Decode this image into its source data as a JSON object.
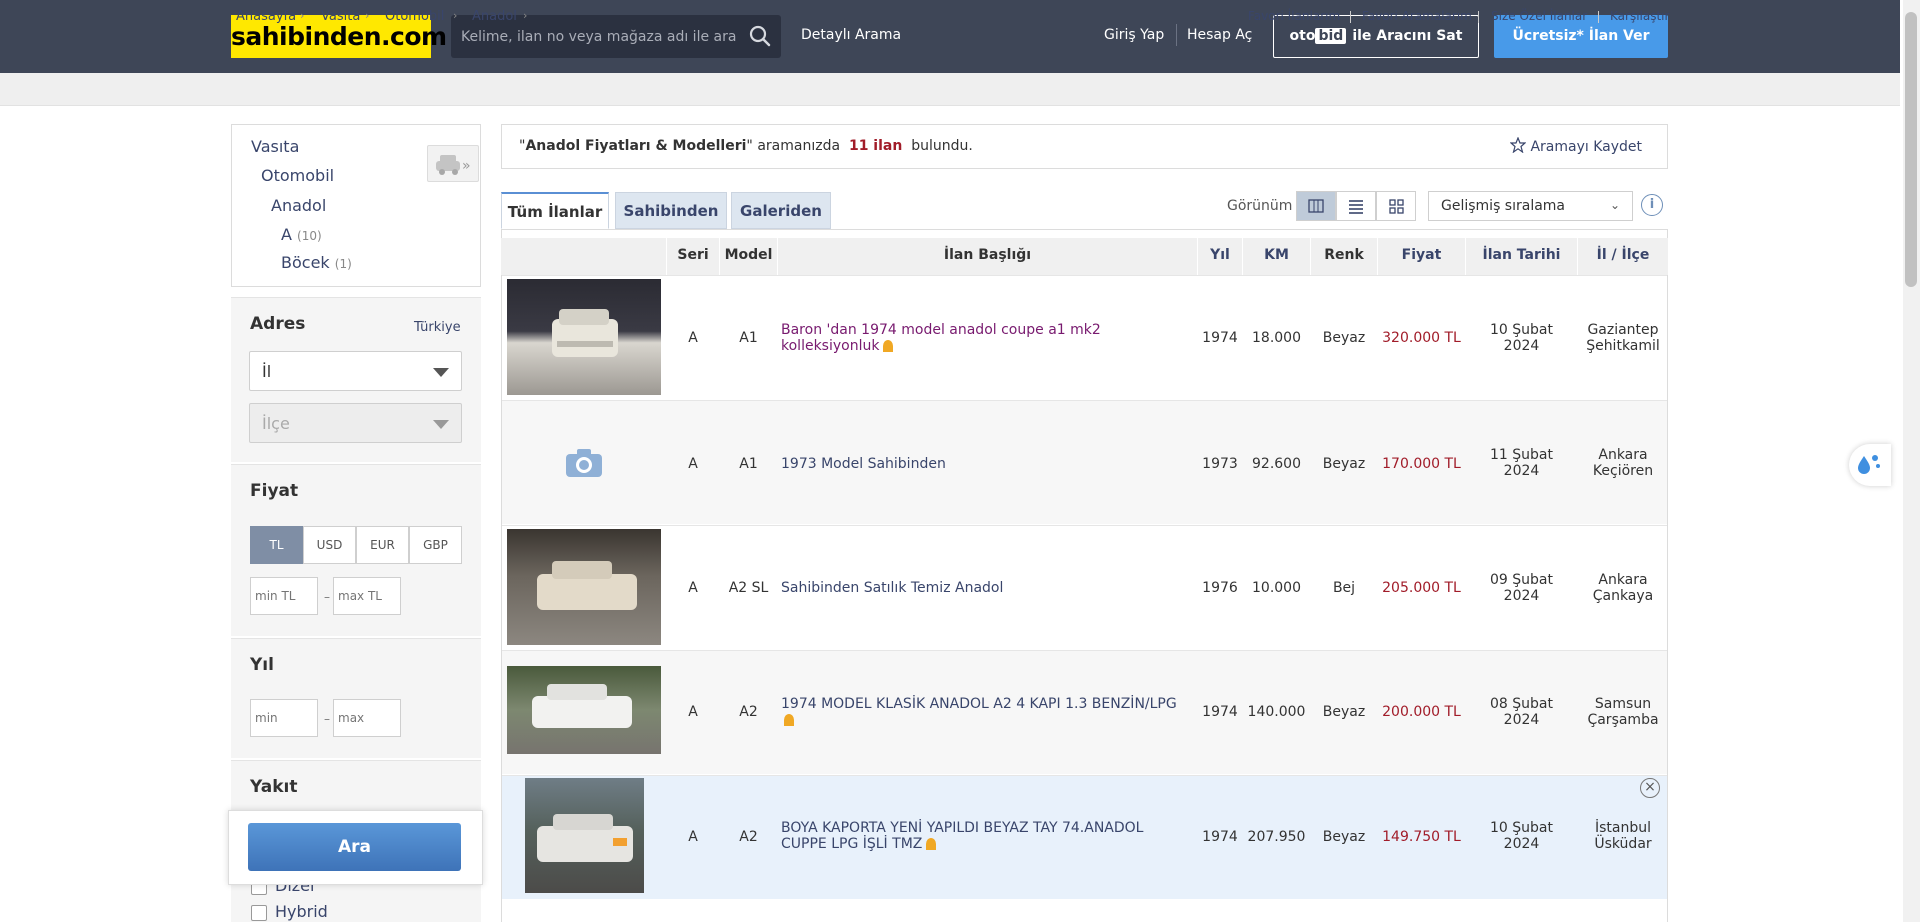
{
  "header": {
    "logo": "sahibinden.com",
    "search_placeholder": "Kelime, ilan no veya mağaza adı ile ara",
    "detailed_search": "Detaylı Arama",
    "login": "Giriş Yap",
    "register": "Hesap Aç",
    "otobid_oto": "oto",
    "otobid_bid": "bid",
    "otobid_text": "ile Aracını Sat",
    "post_ad": "Ücretsiz* İlan Ver"
  },
  "breadcrumb": [
    "Anasayfa",
    "Vasıta",
    "Otomobil",
    "Anadol"
  ],
  "util_links": [
    "Favori İlanlarım",
    "Favori Aramalarım",
    "Size Özel İlanlar",
    "Karşılaştır"
  ],
  "categories": {
    "vasita": "Vasıta",
    "otomobil": "Otomobil",
    "anadol": "Anadol",
    "a": "A",
    "a_count": "(10)",
    "bocek": "Böcek",
    "bocek_count": "(1)"
  },
  "filters": {
    "adres_title": "Adres",
    "adres_scope": "Türkiye",
    "il": "İl",
    "ilce": "İlçe",
    "fiyat_title": "Fiyat",
    "currencies": [
      "TL",
      "USD",
      "EUR",
      "GBP"
    ],
    "min_tl": "min TL",
    "max_tl": "max TL",
    "yil_title": "Yıl",
    "min": "min",
    "max": "max",
    "dash": "–",
    "yakit_title": "Yakıt",
    "fuel_options": [
      "Dizel",
      "Hybrid"
    ],
    "search_button": "Ara"
  },
  "results": {
    "query_open": "\"",
    "query": "Anadol Fiyatları & Modelleri",
    "query_close": "\"",
    "text_mid": "aramanızda",
    "count": "11 ilan",
    "text_end": "bulundu.",
    "save_search": "Aramayı Kaydet"
  },
  "tabs": [
    "Tüm İlanlar",
    "Sahibinden",
    "Galeriden"
  ],
  "view_label": "Görünüm",
  "sort": "Gelişmiş sıralama",
  "columns": [
    "Seri",
    "Model",
    "İlan Başlığı",
    "Yıl",
    "KM",
    "Renk",
    "Fiyat",
    "İlan Tarihi",
    "İl / İlçe"
  ],
  "listings": [
    {
      "seri": "A",
      "model": "A1",
      "title": "Baron 'dan 1974 model anadol coupe a1 mk2 kolleksiyonluk",
      "yil": "1974",
      "km": "18.000",
      "renk": "Beyaz",
      "fiyat": "320.000 TL",
      "tarih_1": "10 Şubat",
      "tarih_2": "2024",
      "il": "Gaziantep",
      "ilce": "Şehitkamil"
    },
    {
      "seri": "A",
      "model": "A1",
      "title": "1973 Model Sahibinden",
      "yil": "1973",
      "km": "92.600",
      "renk": "Beyaz",
      "fiyat": "170.000 TL",
      "tarih_1": "11 Şubat",
      "tarih_2": "2024",
      "il": "Ankara",
      "ilce": "Keçiören"
    },
    {
      "seri": "A",
      "model": "A2 SL",
      "title": "Sahibinden Satılık Temiz Anadol",
      "yil": "1976",
      "km": "10.000",
      "renk": "Bej",
      "fiyat": "205.000 TL",
      "tarih_1": "09 Şubat",
      "tarih_2": "2024",
      "il": "Ankara",
      "ilce": "Çankaya"
    },
    {
      "seri": "A",
      "model": "A2",
      "title": "1974 MODEL KLASİK ANADOL A2 4 KAPI 1.3 BENZİN/LPG",
      "yil": "1974",
      "km": "140.000",
      "renk": "Beyaz",
      "fiyat": "200.000 TL",
      "tarih_1": "08 Şubat",
      "tarih_2": "2024",
      "il": "Samsun",
      "ilce": "Çarşamba"
    },
    {
      "seri": "A",
      "model": "A2",
      "title": "BOYA KAPORTA YENİ YAPILDI BEYAZ TAY 74.ANADOL CUPPE LPG İŞLİ TMZ",
      "yil": "1974",
      "km": "207.950",
      "renk": "Beyaz",
      "fiyat": "149.750 TL",
      "tarih_1": "10 Şubat",
      "tarih_2": "2024",
      "il": "İstanbul",
      "ilce": "Üsküdar"
    }
  ],
  "colors": {
    "header_bg": "#3e4657",
    "logo_yellow": "#ffe800",
    "post_ad_blue": "#489ae9",
    "link_blue": "#39456b",
    "price_red": "#a11c29"
  }
}
